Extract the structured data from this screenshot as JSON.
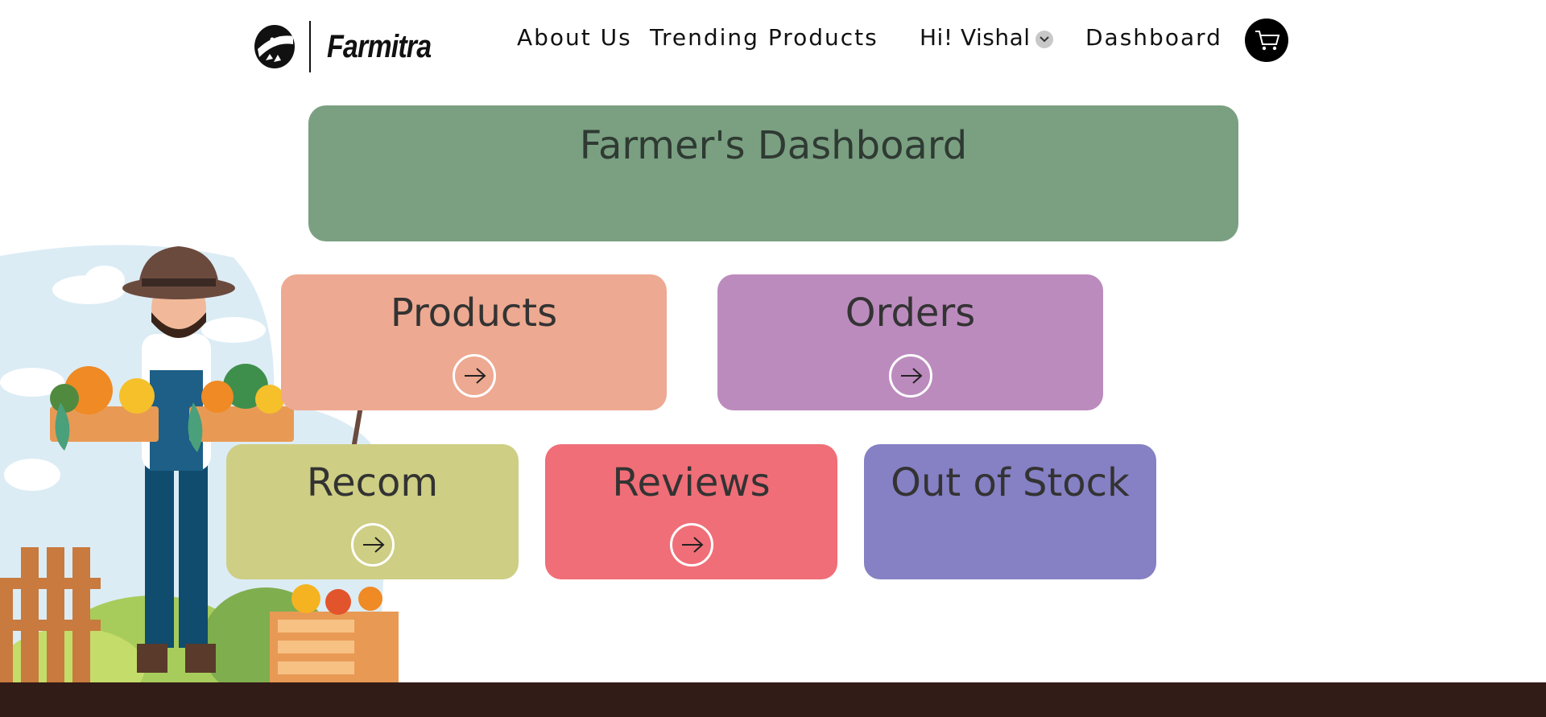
{
  "brand": {
    "name": "Farmitra"
  },
  "nav": {
    "about": "About Us",
    "trending": "Trending Products",
    "user": "Hi! Vishal",
    "dashboard": "Dashboard"
  },
  "banner": {
    "title": "Farmer's Dashboard"
  },
  "cards": [
    {
      "title": "Products",
      "color": "#eda991",
      "has_arrow": true
    },
    {
      "title": "Orders",
      "color": "#bc8bbe",
      "has_arrow": true
    },
    {
      "title": "Recom",
      "color": "#cece84",
      "has_arrow": true
    },
    {
      "title": "Reviews",
      "color": "#f06e77",
      "has_arrow": true
    },
    {
      "title": "Out of Stock",
      "color": "#8680c4",
      "has_arrow": false
    }
  ],
  "icons": {
    "logo": "farmitra-logo-icon",
    "user_menu": "chevron-down-icon",
    "cart": "cart-icon",
    "card_arrow": "arrow-right-icon"
  },
  "colors": {
    "banner": "#7aa081",
    "footer": "#321c18",
    "cart_bg": "#000000"
  }
}
